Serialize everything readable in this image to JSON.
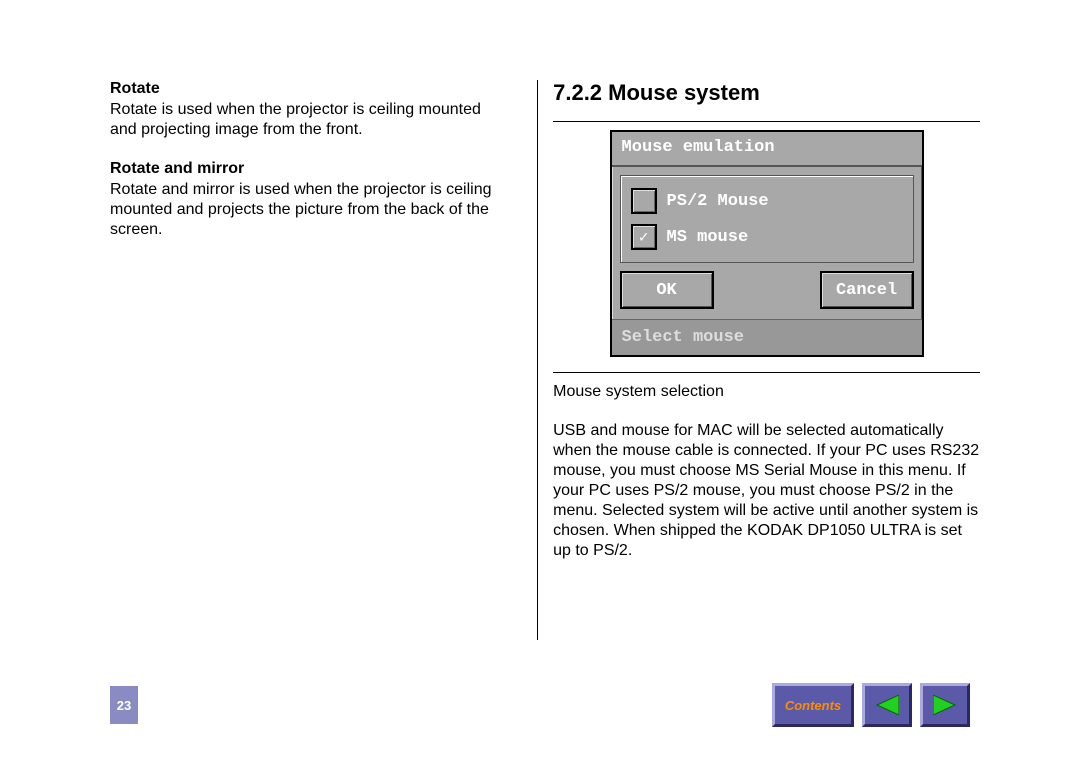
{
  "leftColumn": {
    "sections": [
      {
        "title": "Rotate",
        "body": "Rotate is used when the projector is ceiling mounted and projecting image from the front."
      },
      {
        "title": "Rotate and mirror",
        "body": "Rotate and mirror is used when the projector is ceiling mounted and projects the picture from the back of the screen."
      }
    ]
  },
  "rightColumn": {
    "heading": "7.2.2  Mouse system",
    "embed": {
      "title": "Mouse emulation",
      "options": [
        {
          "label": "PS/2 Mouse",
          "checked": false
        },
        {
          "label": "MS mouse",
          "checked": true
        }
      ],
      "buttons": {
        "ok": "OK",
        "cancel": "Cancel"
      },
      "status": "Select mouse"
    },
    "caption": "Mouse system selection",
    "body": "USB and mouse for MAC will be selected automatically when the mouse cable is connected. If your PC uses RS232 mouse, you must choose MS Serial Mouse in this menu. If your PC uses PS/2 mouse, you must choose PS/2 in the menu. Selected system will be active until another system is chosen. When shipped the KODAK DP1050 ULTRA is set up to PS/2."
  },
  "footer": {
    "pageNumber": "23",
    "contents": "Contents"
  }
}
